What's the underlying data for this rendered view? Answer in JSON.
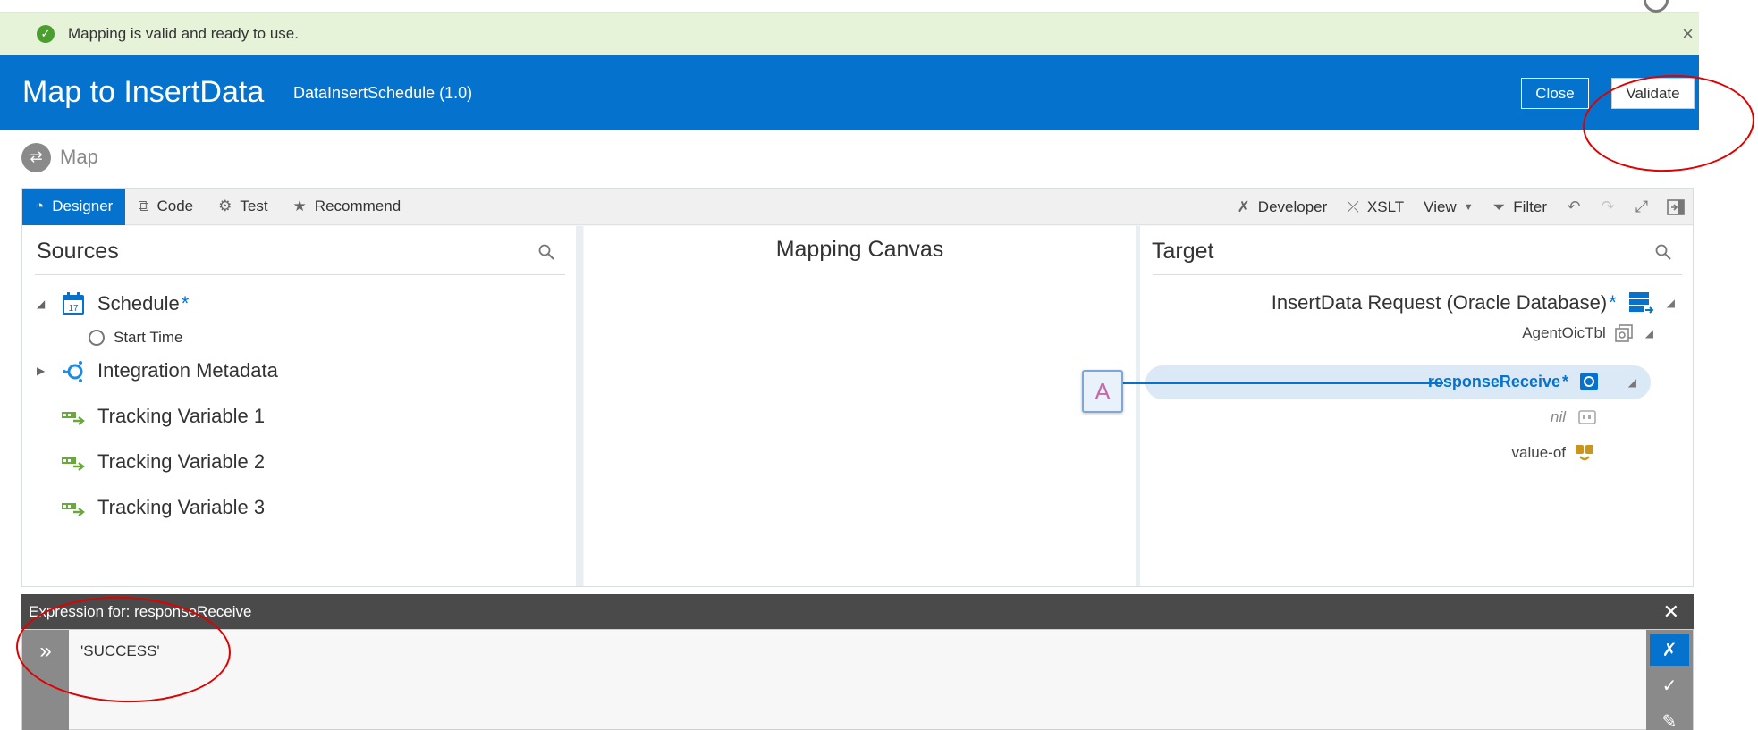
{
  "notification": {
    "message": "Mapping is valid and ready to use.",
    "dismiss": "×"
  },
  "header": {
    "title": "Map to InsertData",
    "subtitle": "DataInsertSchedule (1.0)",
    "close_label": "Close",
    "validate_label": "Validate"
  },
  "map_label": "Map",
  "toolbar": {
    "left": [
      {
        "label": "Designer",
        "icon": "designer-icon",
        "active": true
      },
      {
        "label": "Code",
        "icon": "code-icon",
        "active": false
      },
      {
        "label": "Test",
        "icon": "gear-icon",
        "active": false
      },
      {
        "label": "Recommend",
        "icon": "star-icon",
        "active": false
      }
    ],
    "right": [
      {
        "label": "Developer",
        "icon": "wrench-icon"
      },
      {
        "label": "XSLT",
        "icon": "xslt-icon"
      },
      {
        "label": "View",
        "icon": "chevron-down-icon"
      },
      {
        "label": "Filter",
        "icon": "filter-icon"
      }
    ]
  },
  "sources": {
    "title": "Sources",
    "items": [
      {
        "label": "Schedule",
        "required": "*",
        "expanded": true
      },
      {
        "label": "Start Time"
      },
      {
        "label": "Integration Metadata"
      },
      {
        "label": "Tracking Variable 1"
      },
      {
        "label": "Tracking Variable 2"
      },
      {
        "label": "Tracking Variable 3"
      }
    ],
    "schedule_day": "17"
  },
  "canvas": {
    "title": "Mapping Canvas",
    "function_label": "A"
  },
  "target": {
    "title": "Target",
    "root": "InsertData Request (Oracle Database)",
    "root_required": "*",
    "agent": "AgentOicTbl",
    "response": "responseReceive",
    "response_required": "*",
    "nil": "nil",
    "value_of": "value-of"
  },
  "expression": {
    "header_prefix": "Expression for: ",
    "header_field": "responseReceive",
    "value": "'SUCCESS'"
  },
  "colors": {
    "accent": "#0572ce",
    "success_bg": "#e6f3d9",
    "annotation": "#e00000"
  }
}
